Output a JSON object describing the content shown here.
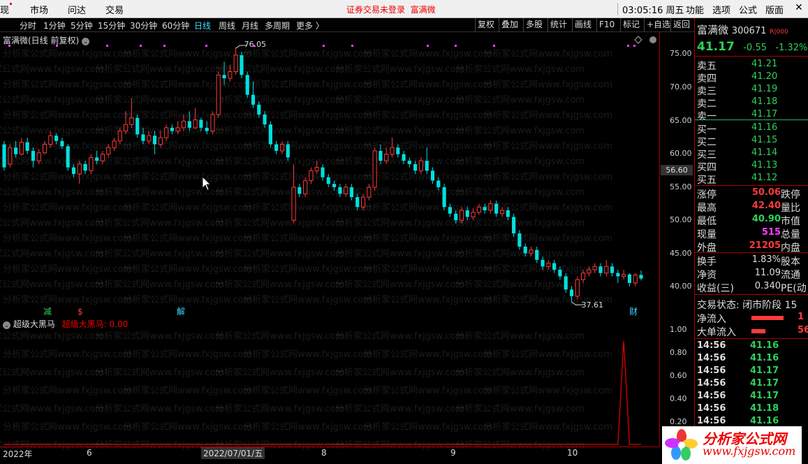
{
  "topbar": {
    "menus": [
      "现",
      "市场",
      "问达",
      "交易"
    ],
    "notice": "证券交易未登录",
    "notice_stock": "富满微",
    "clock": "03:05:16 周五",
    "right_menus": [
      "功能",
      "选项",
      "公式",
      "版面"
    ],
    "win_controls": [
      "—",
      "□",
      "✕"
    ]
  },
  "toolbar": {
    "periods": [
      "分时",
      "1分钟",
      "5分钟",
      "15分钟",
      "30分钟",
      "60分钟",
      "日线",
      "周线",
      "月线",
      "多周期",
      "更多 〉"
    ],
    "active_period": "日线",
    "buttons": [
      "复权",
      "叠加",
      "多股",
      "统计",
      "画线",
      "F10",
      "标记",
      "+自选",
      "返回"
    ]
  },
  "main_chart": {
    "title": "富满微(日线 前复权)",
    "current_price_label": "56.60",
    "high_marker": "76.05",
    "low_marker": "37.61",
    "markers": [
      "减",
      "$",
      "解",
      "财"
    ]
  },
  "indicator": {
    "name": "超级大黑马",
    "value_label": "超级大黑马: 0.00"
  },
  "datebar": {
    "labels": [
      "2022年",
      "6",
      "8",
      "9",
      "10"
    ],
    "cursor": "2022/07/01/五"
  },
  "panel": {
    "name": "富满微",
    "code": "300671",
    "badge": "R|000",
    "price": "41.17",
    "change": "-0.55",
    "change_pct": "-1.32%",
    "asks": [
      {
        "label": "卖五",
        "price": "41.21"
      },
      {
        "label": "卖四",
        "price": "41.20"
      },
      {
        "label": "卖三",
        "price": "41.19"
      },
      {
        "label": "卖二",
        "price": "41.18"
      },
      {
        "label": "卖一",
        "price": "41.17"
      }
    ],
    "bids": [
      {
        "label": "买一",
        "price": "41.16"
      },
      {
        "label": "买二",
        "price": "41.15"
      },
      {
        "label": "买三",
        "price": "41.14"
      },
      {
        "label": "买四",
        "price": "41.13"
      },
      {
        "label": "买五",
        "price": "41.12"
      }
    ],
    "stats": [
      {
        "label": "涨停",
        "value": "50.06",
        "label2": "跌停"
      },
      {
        "label": "最高",
        "value": "42.40",
        "label2": "量比"
      },
      {
        "label": "最低",
        "value": "40.90",
        "label2": "市值"
      },
      {
        "label": "现量",
        "value": "515",
        "label2": "总量"
      },
      {
        "label": "外盘",
        "value": "21205",
        "label2": "内盘"
      }
    ],
    "fundamentals": [
      {
        "label": "换手",
        "value": "1.83%",
        "label2": "股本"
      },
      {
        "label": "净资",
        "value": "11.09",
        "label2": "流通"
      },
      {
        "label": "收益(三)",
        "value": "0.340",
        "label2": "PE(动"
      }
    ],
    "trade_status": "交易状态: 闭市阶段 15",
    "flows": [
      {
        "label": "净流入",
        "value": "1"
      },
      {
        "label": "大单流入",
        "value": "56"
      }
    ],
    "ticks": [
      {
        "time": "14:56",
        "price": "41.16"
      },
      {
        "time": "14:56",
        "price": "41.16"
      },
      {
        "time": "14:56",
        "price": "41.17"
      },
      {
        "time": "14:56",
        "price": "41.17"
      },
      {
        "time": "14:56",
        "price": "41.17"
      },
      {
        "time": "14:56",
        "price": "41.18"
      },
      {
        "time": "14:56",
        "price": "41.16"
      }
    ]
  },
  "watermark": "分析家公式网www.fxjgsw.com",
  "logo": {
    "text": "分析家公式网",
    "url": "www.fxjgsw.com"
  },
  "main_axis": [
    "75.00",
    "70.00",
    "65.00",
    "60.00",
    "55.00",
    "50.00",
    "45.00",
    "40.00"
  ],
  "indicator_axis": [
    "1.00",
    "0.80",
    "0.60",
    "0.40",
    "0.20"
  ],
  "chart_data": {
    "type": "candlestick",
    "title": "富满微(日线 前复权)",
    "ylim": [
      37,
      77
    ],
    "candles": [
      [
        61.5,
        58.0,
        62.0,
        57.5
      ],
      [
        58.5,
        61.0,
        61.5,
        58.0
      ],
      [
        61.0,
        60.0,
        62.0,
        59.5
      ],
      [
        60.0,
        61.8,
        62.5,
        59.8
      ],
      [
        61.8,
        60.5,
        62.5,
        60.0
      ],
      [
        60.5,
        59.0,
        61.0,
        58.0
      ],
      [
        59.0,
        60.2,
        60.8,
        58.5
      ],
      [
        60.2,
        61.5,
        62.0,
        60.0
      ],
      [
        61.5,
        62.8,
        63.5,
        61.0
      ],
      [
        62.8,
        62.0,
        63.2,
        61.5
      ],
      [
        62.0,
        61.2,
        62.5,
        60.8
      ],
      [
        61.2,
        58.0,
        61.5,
        57.5
      ],
      [
        58.0,
        57.0,
        58.5,
        56.5
      ],
      [
        57.0,
        58.5,
        59.0,
        55.5
      ],
      [
        58.5,
        57.5,
        59.0,
        57.0
      ],
      [
        57.5,
        59.5,
        60.0,
        57.0
      ],
      [
        59.5,
        59.0,
        60.5,
        58.5
      ],
      [
        59.0,
        60.0,
        60.5,
        58.5
      ],
      [
        60.0,
        61.0,
        61.5,
        59.5
      ],
      [
        61.0,
        62.0,
        62.5,
        60.5
      ],
      [
        62.0,
        63.5,
        64.0,
        61.5
      ],
      [
        63.5,
        64.5,
        66.5,
        63.0
      ],
      [
        64.5,
        65.5,
        68.5,
        64.0
      ],
      [
        65.5,
        63.0,
        66.0,
        62.5
      ],
      [
        63.0,
        62.0,
        64.0,
        61.5
      ],
      [
        62.0,
        62.8,
        63.5,
        61.5
      ],
      [
        62.8,
        61.5,
        63.5,
        60.0
      ],
      [
        61.5,
        62.5,
        63.5,
        61.0
      ],
      [
        62.5,
        64.0,
        64.5,
        62.0
      ],
      [
        64.0,
        63.5,
        64.5,
        63.0
      ],
      [
        63.5,
        64.0,
        65.0,
        63.0
      ],
      [
        64.0,
        65.0,
        66.0,
        63.5
      ],
      [
        65.0,
        64.0,
        66.5,
        63.5
      ],
      [
        64.0,
        65.2,
        67.0,
        63.8
      ],
      [
        65.2,
        64.0,
        65.5,
        63.5
      ],
      [
        64.0,
        63.5,
        65.0,
        63.0
      ],
      [
        63.5,
        66.0,
        66.5,
        63.0
      ],
      [
        66.0,
        72.0,
        72.5,
        65.5
      ],
      [
        72.0,
        71.5,
        74.0,
        70.5
      ],
      [
        71.5,
        72.5,
        73.5,
        71.0
      ],
      [
        72.5,
        75.0,
        76.05,
        72.0
      ],
      [
        75.0,
        72.0,
        75.5,
        71.5
      ],
      [
        72.0,
        69.0,
        72.5,
        68.5
      ],
      [
        69.0,
        67.5,
        71.0,
        67.0
      ],
      [
        67.5,
        66.0,
        68.0,
        65.5
      ],
      [
        66.0,
        64.5,
        66.5,
        64.0
      ],
      [
        64.5,
        61.5,
        65.0,
        61.0
      ],
      [
        61.5,
        60.5,
        62.0,
        60.0
      ],
      [
        60.5,
        61.5,
        62.0,
        60.0
      ],
      [
        61.5,
        59.5,
        62.0,
        59.0
      ],
      [
        50.0,
        55.0,
        58.5,
        49.5
      ],
      [
        55.0,
        54.0,
        55.5,
        53.5
      ],
      [
        54.0,
        56.0,
        56.5,
        53.5
      ],
      [
        56.0,
        57.5,
        58.0,
        55.5
      ],
      [
        57.5,
        58.0,
        59.0,
        57.0
      ],
      [
        58.0,
        56.5,
        58.5,
        56.0
      ],
      [
        56.5,
        55.5,
        57.0,
        55.0
      ],
      [
        55.5,
        55.0,
        56.0,
        54.5
      ],
      [
        55.0,
        54.0,
        55.5,
        53.5
      ],
      [
        54.0,
        55.0,
        55.5,
        53.5
      ],
      [
        55.0,
        53.5,
        55.5,
        53.0
      ],
      [
        53.5,
        52.0,
        54.0,
        51.5
      ],
      [
        52.0,
        53.5,
        54.0,
        51.5
      ],
      [
        53.5,
        55.0,
        55.5,
        53.0
      ],
      [
        55.0,
        60.5,
        61.0,
        54.5
      ],
      [
        60.5,
        59.0,
        61.5,
        58.5
      ],
      [
        59.0,
        60.0,
        61.0,
        58.5
      ],
      [
        60.0,
        61.0,
        62.5,
        59.5
      ],
      [
        61.0,
        60.0,
        61.5,
        59.5
      ],
      [
        60.0,
        59.0,
        60.5,
        58.5
      ],
      [
        59.0,
        58.5,
        59.5,
        58.0
      ],
      [
        58.5,
        57.5,
        59.0,
        57.0
      ],
      [
        57.5,
        59.0,
        59.5,
        57.0
      ],
      [
        59.0,
        57.5,
        61.0,
        57.0
      ],
      [
        57.5,
        56.0,
        58.0,
        55.5
      ],
      [
        56.0,
        55.0,
        56.5,
        54.5
      ],
      [
        55.0,
        52.0,
        55.5,
        51.5
      ],
      [
        52.0,
        51.0,
        52.5,
        50.5
      ],
      [
        51.0,
        50.0,
        51.5,
        49.5
      ],
      [
        50.0,
        51.5,
        52.0,
        49.5
      ],
      [
        51.5,
        50.5,
        52.0,
        50.0
      ],
      [
        50.5,
        51.2,
        51.8,
        50.0
      ],
      [
        51.2,
        52.0,
        52.5,
        50.8
      ],
      [
        52.0,
        51.5,
        52.5,
        51.0
      ],
      [
        51.5,
        52.5,
        53.0,
        51.0
      ],
      [
        52.5,
        51.0,
        53.0,
        50.5
      ],
      [
        51.0,
        51.5,
        52.0,
        50.5
      ],
      [
        51.5,
        50.5,
        52.0,
        50.0
      ],
      [
        50.5,
        48.0,
        51.0,
        47.5
      ],
      [
        48.0,
        46.0,
        48.5,
        45.5
      ],
      [
        46.0,
        45.0,
        46.5,
        44.5
      ],
      [
        45.0,
        45.5,
        46.0,
        44.5
      ],
      [
        45.5,
        44.0,
        46.0,
        43.5
      ],
      [
        44.0,
        43.0,
        44.5,
        42.5
      ],
      [
        43.0,
        43.5,
        44.0,
        42.5
      ],
      [
        43.5,
        42.5,
        44.0,
        42.0
      ],
      [
        42.5,
        41.5,
        43.0,
        41.0
      ],
      [
        41.5,
        39.5,
        42.0,
        39.0
      ],
      [
        39.5,
        38.5,
        40.0,
        37.61
      ],
      [
        38.5,
        41.0,
        41.5,
        38.0
      ],
      [
        41.0,
        42.0,
        42.5,
        40.5
      ],
      [
        42.0,
        42.5,
        43.0,
        41.5
      ],
      [
        42.5,
        43.0,
        43.5,
        42.0
      ],
      [
        43.0,
        42.0,
        43.5,
        41.5
      ],
      [
        42.0,
        43.0,
        44.0,
        41.5
      ],
      [
        43.0,
        42.0,
        43.5,
        41.5
      ],
      [
        42.0,
        41.5,
        42.5,
        40.5
      ],
      [
        41.5,
        41.8,
        42.5,
        41.0
      ],
      [
        41.8,
        40.5,
        42.0,
        40.0
      ],
      [
        40.5,
        41.7,
        42.0,
        40.0
      ],
      [
        41.72,
        41.17,
        42.4,
        40.9
      ]
    ],
    "indicator": {
      "name": "超级大黑马",
      "ylim": [
        0,
        1.1
      ],
      "spike_index": 107,
      "spike_value": 1.0
    }
  }
}
